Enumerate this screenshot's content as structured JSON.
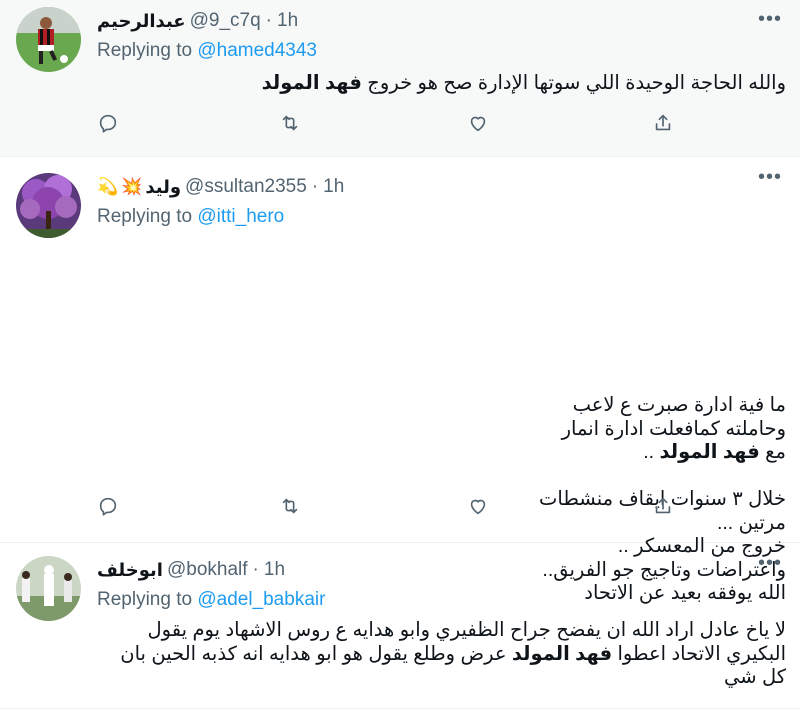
{
  "tweets": [
    {
      "name": "عبدالرحيم",
      "handle": "@9_c7q",
      "dot": "·",
      "time": "1h",
      "replying_prefix": "Replying to",
      "replying_to": "@hamed4343",
      "text_plain": "والله الحاجة الوحيدة اللي سوتها الإدارة صح هو خروج ",
      "text_bold": "فهد المولد",
      "avatar_icon": "soccer-player-avatar"
    },
    {
      "name": "وليد",
      "name_emoji": "💥",
      "name_emoji2": "💫",
      "handle": "@ssultan2355",
      "dot": "·",
      "time": "1h",
      "replying_prefix": "Replying to",
      "replying_to": "@itti_hero",
      "lines": [
        "ما فية ادارة صبرت ع لاعب",
        "وحاملته كمافعلت ادارة انمار",
        "مع",
        "فهد المولد",
        "..",
        "خلال ٣ سنوات ايقاف منشطات",
        "مرتين ...",
        "خروج من المعسكر ..",
        "واعتراضات وتاجيج جو الفريق..",
        "الله يوفقه بعيد عن الاتحاد"
      ],
      "avatar_icon": "purple-tree-avatar"
    },
    {
      "name": "ابوخلف",
      "handle": "@bokhalf",
      "dot": "·",
      "time": "1h",
      "replying_prefix": "Replying to",
      "replying_to": "@adel_babkair",
      "text_part1": "لا ياخ عادل اراد الله ان يفضح جراح الظفيري وابو هدايه ع روس الاشهاد يوم يقول البكيري الاتحاد اعطوا ",
      "text_bold": "فهد المولد",
      "text_part2": " عرض وطلع يقول هو ابو هدايه انه كذبه الحين بان كل شي",
      "avatar_icon": "people-outdoor-avatar"
    }
  ],
  "colors": {
    "accent": "#1d9bf0",
    "secondary_text": "#536471",
    "highlight_bg": "#f7f9f9"
  },
  "icons": [
    "reply-icon",
    "retweet-icon",
    "like-icon",
    "share-icon",
    "more-icon"
  ]
}
